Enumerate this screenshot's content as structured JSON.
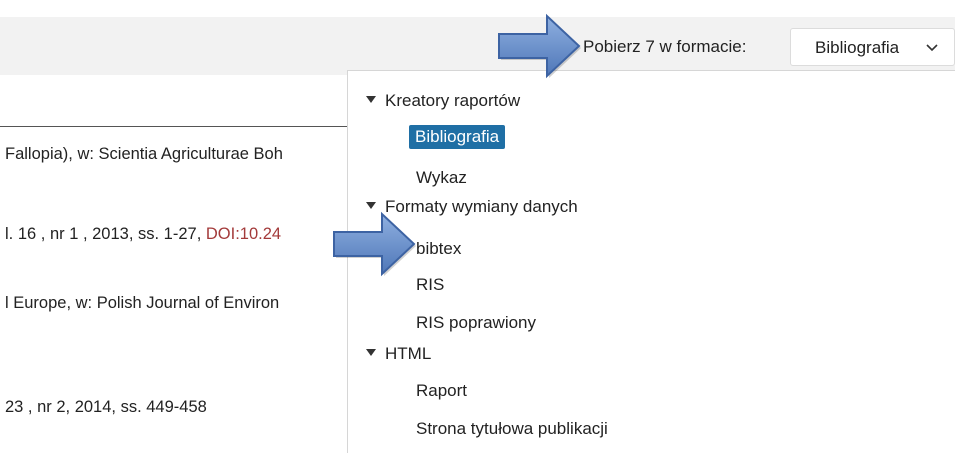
{
  "toolbar": {
    "export_label": "Pobierz 7 w formacie:",
    "format_select_value": "Bibliografia"
  },
  "results": {
    "rows": [
      "Fallopia), w: Scientia Agriculturae Boh",
      "l. 16 , nr 1 , 2013, ss. 1-27, ",
      "l Europe, w: Polish Journal of Environ",
      "23 , nr 2, 2014, ss. 449-458"
    ],
    "doi_fragment": "DOI:10.24"
  },
  "dropdown": {
    "groups": [
      {
        "label": "Kreatory raportów",
        "items": [
          "Bibliografia",
          "Wykaz"
        ]
      },
      {
        "label": "Formaty wymiany danych",
        "items": [
          "bibtex",
          "RIS",
          "RIS poprawiony"
        ]
      },
      {
        "label": "HTML",
        "items": [
          "Raport",
          "Strona tytułowa publikacji"
        ]
      }
    ],
    "selected": "Bibliografia"
  },
  "colors": {
    "accent": "#1f6fa5",
    "doi": "#a33a3a",
    "arrow": "#5b86c4"
  }
}
